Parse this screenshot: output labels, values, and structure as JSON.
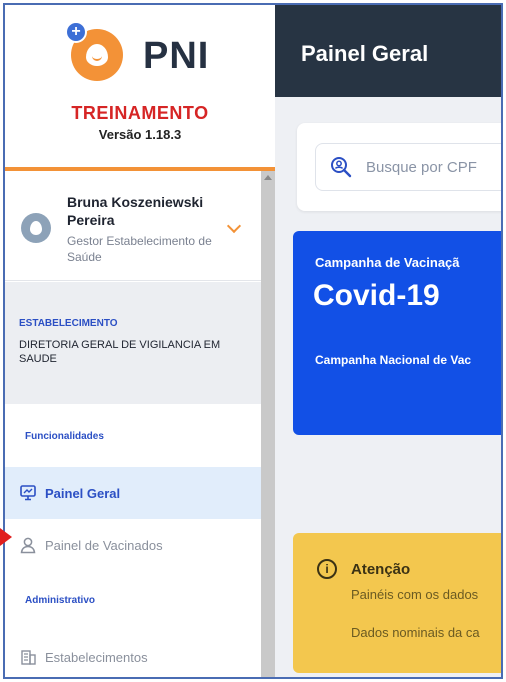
{
  "brand": {
    "logo_text": "PNI",
    "environment": "TREINAMENTO",
    "version": "Versão 1.18.3"
  },
  "user": {
    "name": "Bruna Koszeniewski Pereira",
    "role": "Gestor Estabelecimento de Saúde"
  },
  "establishment": {
    "label": "ESTABELECIMENTO",
    "name": "DIRETORIA GERAL DE VIGILANCIA EM SAUDE"
  },
  "nav": {
    "section_functionalities": "Funcionalidades",
    "painel_geral": "Painel Geral",
    "painel_vacinados": "Painel de Vacinados",
    "section_admin": "Administrativo",
    "estabelecimentos": "Estabelecimentos"
  },
  "header": {
    "title": "Painel Geral"
  },
  "search": {
    "placeholder": "Busque por CPF"
  },
  "campaign": {
    "label": "Campanha de Vacinaçã",
    "title": "Covid-19",
    "subtitle": "Campanha Nacional de Vac"
  },
  "attention": {
    "title": "Atenção",
    "line1": "Painéis com os dados",
    "line2": "Dados nominais da ca"
  },
  "colors": {
    "accent_orange": "#f39237",
    "primary_blue": "#1250e6",
    "header_dark": "#273443",
    "warning_yellow": "#f3c74e",
    "environment_red": "#d62525"
  }
}
